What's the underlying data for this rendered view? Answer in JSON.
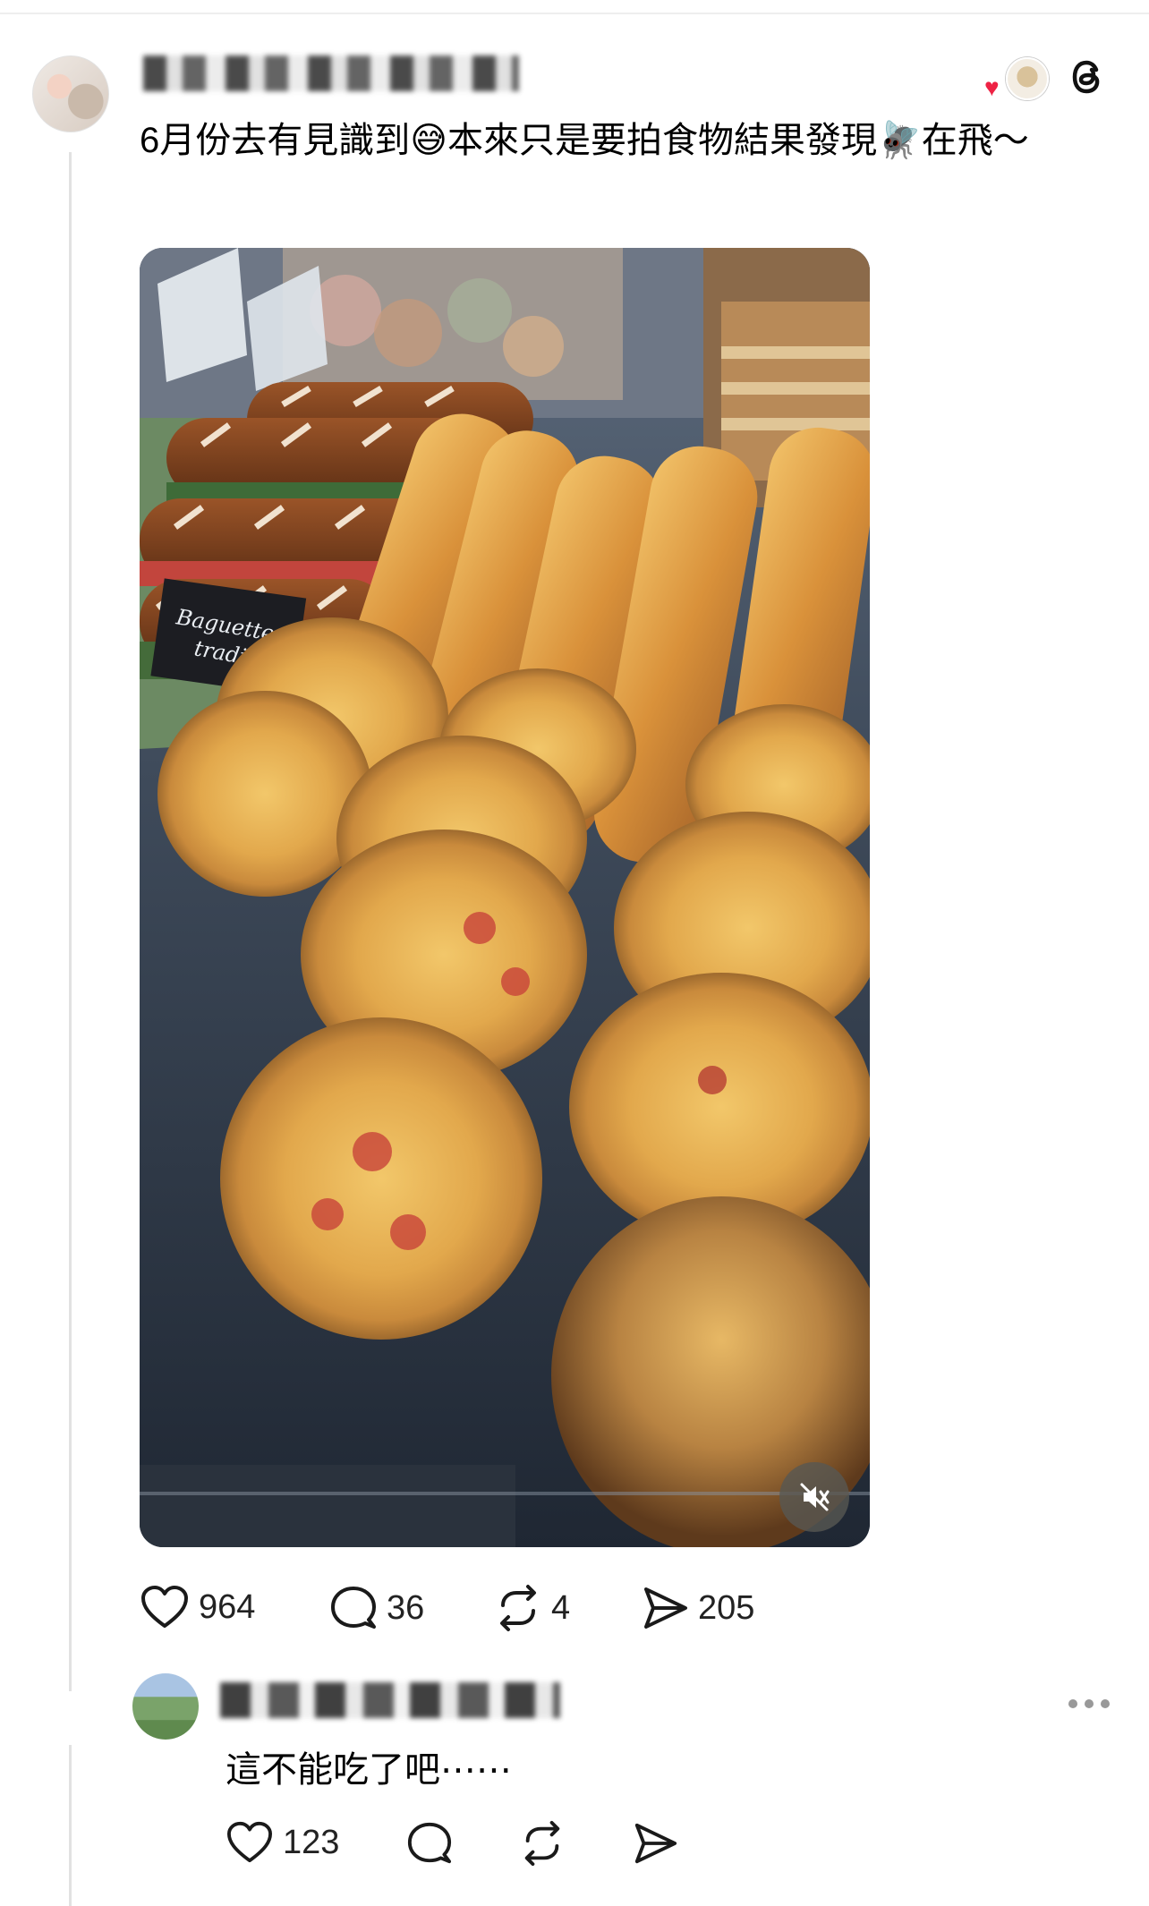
{
  "post": {
    "author_hidden": true,
    "text": "6月份去有見識到😅本來只是要拍食物結果發現🪰在飛～",
    "media": {
      "type": "video",
      "description_icon": "bakery-display-case",
      "mute_icon": "speaker-muted-icon"
    },
    "stats": {
      "likes": "964",
      "comments": "36",
      "reposts": "4",
      "shares": "205"
    },
    "reactor_heart_icon": "heart-icon"
  },
  "reply": {
    "author_hidden": true,
    "text": "這不能吃了吧⋯⋯",
    "stats": {
      "likes": "123"
    }
  },
  "colors": {
    "heart_badge": "#ee2244",
    "icon_stroke": "#1a1a1a",
    "count_text": "#222222",
    "divider": "#e2e2e2"
  }
}
